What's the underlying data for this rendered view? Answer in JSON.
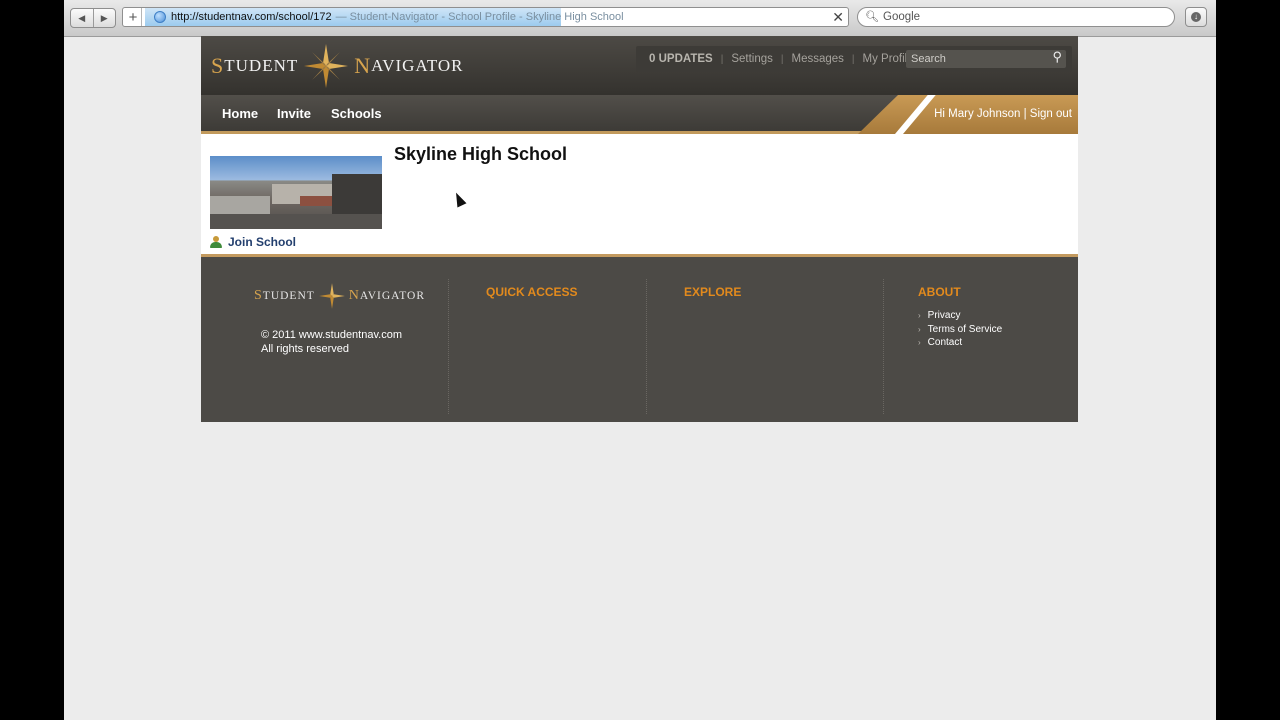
{
  "browser": {
    "url": "http://studentnav.com/school/172",
    "tab_title": "— Student-Navigator - School Profile - Skyline High School",
    "search_placeholder": "Google",
    "back_glyph": "◀",
    "forward_glyph": "▶",
    "plus_glyph": "+",
    "stop_glyph": "✕"
  },
  "site": {
    "logo": {
      "word1_cap": "S",
      "word1_rest": "tudent",
      "word2_cap": "N",
      "word2_rest": "avigator"
    },
    "top_links": {
      "updates": "0 UPDATES",
      "settings": "Settings",
      "messages": "Messages",
      "my_profile": "My Profile",
      "search_placeholder": "Search",
      "separator": "|"
    },
    "nav": {
      "home": "Home",
      "invite": "Invite",
      "schools": "Schools",
      "greeting": "Hi Mary Johnson",
      "greeting_sep": "|",
      "sign_out": "Sign out"
    },
    "school": {
      "title": "Skyline High School",
      "join_label": "Join School"
    },
    "footer": {
      "copyright_line1": "© 2011 www.studentnav.com",
      "copyright_line2": "All rights reserved",
      "quick_access": "QUICK ACCESS",
      "explore": "EXPLORE",
      "about": "ABOUT",
      "about_links": [
        "Privacy",
        "Terms of Service",
        "Contact"
      ],
      "bullet": "›"
    }
  },
  "colors": {
    "accent_gold": "#c99a55",
    "footer_heading": "#e28a1d",
    "header_dark": "#3f3d39",
    "join_link": "#233f6e"
  },
  "icons": [
    "back-icon",
    "forward-icon",
    "globe-icon",
    "stop-icon",
    "search-icon",
    "download-icon",
    "compass-icon",
    "join-user-icon"
  ]
}
